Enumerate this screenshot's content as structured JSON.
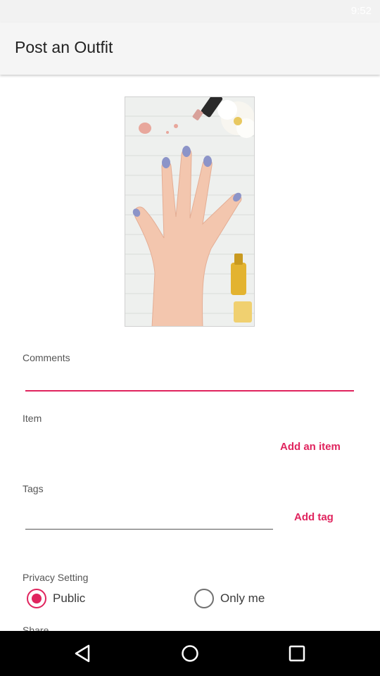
{
  "status_bar": {
    "time": "9:52"
  },
  "header": {
    "title": "Post an Outfit"
  },
  "comments": {
    "label": "Comments",
    "value": ""
  },
  "item": {
    "label": "Item",
    "add_label": "Add an item"
  },
  "tags": {
    "label": "Tags",
    "value": "",
    "add_label": "Add tag"
  },
  "privacy": {
    "label": "Privacy Setting",
    "options": [
      {
        "label": "Public",
        "selected": true
      },
      {
        "label": "Only me",
        "selected": false
      }
    ]
  },
  "share": {
    "label": "Share"
  },
  "navigation": {
    "buttons": [
      "back-icon",
      "home-icon",
      "recents-icon"
    ]
  },
  "colors": {
    "accent": "#e0245e",
    "nav_background": "#000000"
  }
}
